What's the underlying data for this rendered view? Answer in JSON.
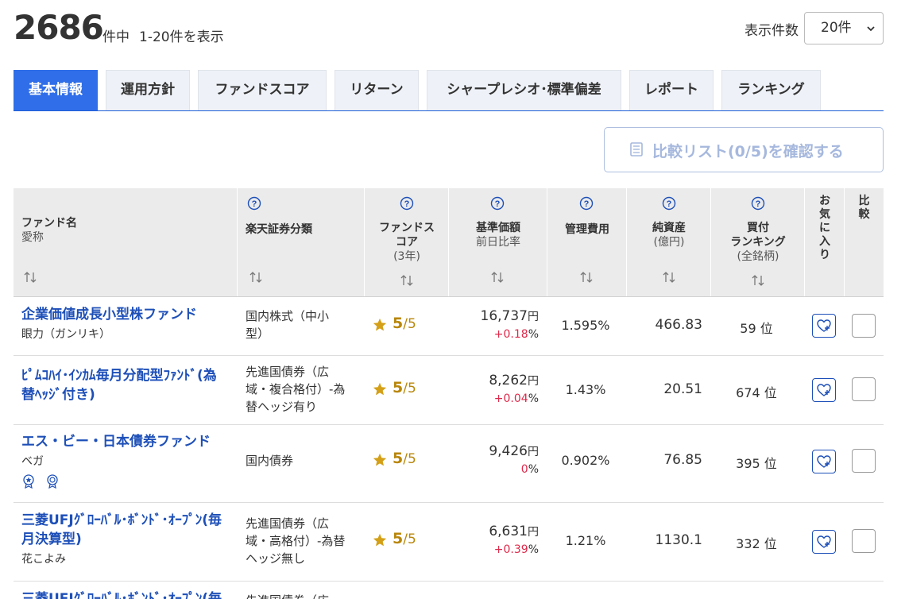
{
  "summary": {
    "total": "2686",
    "unit": "件中",
    "range": "1-20件を表示"
  },
  "per_page": {
    "label": "表示件数",
    "value": "20件"
  },
  "tabs": [
    {
      "label": "基本情報"
    },
    {
      "label": "運用方針"
    },
    {
      "label": "ファンドスコア"
    },
    {
      "label": "リターン"
    },
    {
      "label": "シャープレシオ･標準偏差"
    },
    {
      "label": "レポート"
    },
    {
      "label": "ランキング"
    }
  ],
  "compare_button": {
    "label": "比較リスト(0/5)を確認する"
  },
  "headers": {
    "fund_name": "ファンド名",
    "nickname": "愛称",
    "category": "楽天証券分類",
    "score_l1": "ファンドス",
    "score_l2": "コア",
    "score_sub": "(3年)",
    "nav": "基準価額",
    "nav_sub": "前日比率",
    "fee": "管理費用",
    "assets": "純資産",
    "assets_sub": "(億円)",
    "rank_l1": "買付",
    "rank_l2": "ランキング",
    "rank_sub": "(全銘柄)",
    "fav_chars": [
      "お",
      "気",
      "に",
      "入",
      "り"
    ],
    "compare_chars": [
      "比",
      "較"
    ]
  },
  "rows": [
    {
      "name1": "企業価値成長小型株ファンド",
      "name2": "",
      "nickname": "眼力（ガンリキ）",
      "cat1": "国内株式（中小",
      "cat2": "型）",
      "cat3": "",
      "score": "5",
      "score_den": "/5",
      "price": "16,737",
      "yen": "円",
      "change": "+0.18",
      "pct": "%",
      "fee": "1.595%",
      "assets": "466.83",
      "rank": "59 位"
    },
    {
      "name1": "ﾋﾟﾑｺﾊｲ･ｲﾝｶﾑ毎月分配型ﾌｧﾝﾄﾞ(為",
      "name2": "替ﾍｯｼﾞ付き)",
      "nickname": "",
      "cat1": "先進国債券（広",
      "cat2": "域・複合格付）-為",
      "cat3": "替ヘッジ有り",
      "score": "5",
      "score_den": "/5",
      "price": "8,262",
      "yen": "円",
      "change": "+0.04",
      "pct": "%",
      "fee": "1.43%",
      "assets": "20.51",
      "rank": "674 位"
    },
    {
      "name1": "エス・ビー・日本債券ファンド",
      "name2": "",
      "nickname": "ベガ",
      "cat1": "国内債券",
      "cat2": "",
      "cat3": "",
      "score": "5",
      "score_den": "/5",
      "price": "9,426",
      "yen": "円",
      "change": "0",
      "pct": "%",
      "fee": "0.902%",
      "assets": "76.85",
      "rank": "395 位"
    },
    {
      "name1": "三菱UFJｸﾞﾛｰﾊﾞﾙ･ﾎﾞﾝﾄﾞ･ｵｰﾌﾟﾝ(毎",
      "name2": "月決算型)",
      "nickname": "花こよみ",
      "cat1": "先進国債券（広",
      "cat2": "域・高格付）-為替",
      "cat3": "ヘッジ無し",
      "score": "5",
      "score_den": "/5",
      "price": "6,631",
      "yen": "円",
      "change": "+0.39",
      "pct": "%",
      "fee": "1.21%",
      "assets": "1130.1",
      "rank": "332 位"
    },
    {
      "name1": "三菱UFJｸﾞﾛｰﾊﾞﾙ･ﾎﾞﾝﾄﾞ･ｵｰﾌﾟﾝ(毎",
      "name2": "",
      "nickname": "",
      "cat1": "先進国債券（広",
      "cat2": "",
      "cat3": "",
      "score": "",
      "score_den": "",
      "price": "",
      "yen": "",
      "change": "",
      "pct": "",
      "fee": "",
      "assets": "",
      "rank": ""
    }
  ]
}
